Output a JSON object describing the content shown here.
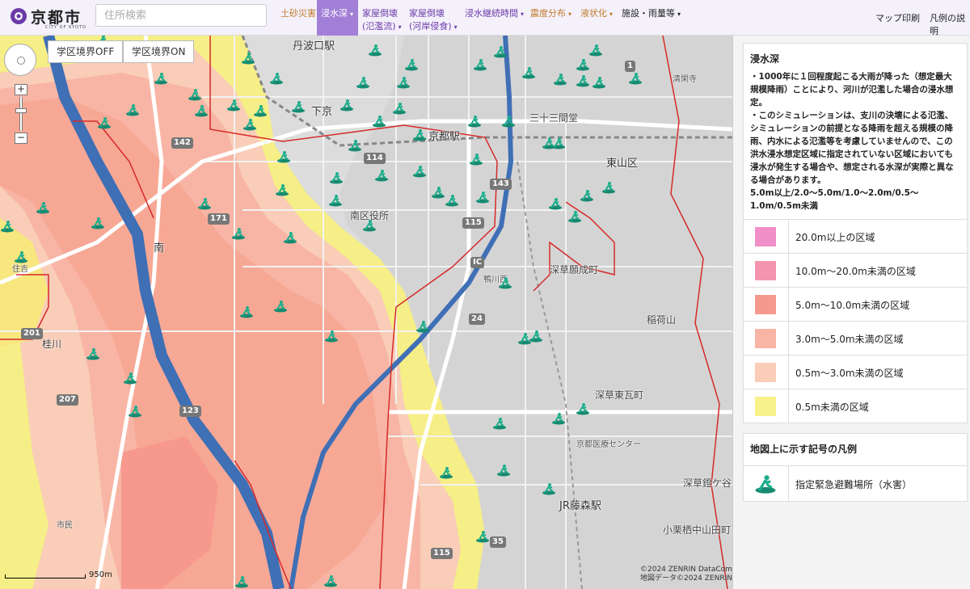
{
  "header": {
    "logo_text": "京都市",
    "logo_sub": "CITY OF KYOTO",
    "search_placeholder": "住所検索",
    "menu": [
      {
        "label": "土砂災害",
        "style": "orange",
        "caret": ""
      },
      {
        "label": "浸水深",
        "style": "active",
        "caret": "▾"
      },
      {
        "label": "家屋倒壊\n(氾濫流)",
        "style": "purple",
        "caret": "▾"
      },
      {
        "label": "家屋倒壊\n(河岸侵食)",
        "style": "purple",
        "caret": "▾"
      },
      {
        "label": "浸水継続時間",
        "style": "purple",
        "caret": "▾"
      },
      {
        "label": "震度分布",
        "style": "orange",
        "caret": "▾"
      },
      {
        "label": "液状化",
        "style": "orange",
        "caret": "▾"
      },
      {
        "label": "施設・雨量等",
        "style": "dark",
        "caret": "▾"
      }
    ],
    "print_label": "マップ印刷",
    "legend_help_label": "凡例の説明"
  },
  "map": {
    "gakku_off": "学区境界OFF",
    "gakku_on": "学区境界ON",
    "zoom_in": "+",
    "zoom_out": "−",
    "scale_label": "950m",
    "copyright_1": "©2024 ZENRIN DataCom",
    "copyright_2": "地図データ©2024 ZENRIN",
    "labels": {
      "tanbaguchi": "丹波口駅",
      "shimogyo": "下京",
      "kyoto_station": "京都駅",
      "sanjusangendo": "三十三間堂",
      "higashiyama": "東山区",
      "minami_office": "南区役所",
      "minami": "南",
      "kamogawa": "鴨川西",
      "fukakusa_ganjo": "深草願成町",
      "inariyama": "稲荷山",
      "fukakusa_higashigawara": "深草東瓦町",
      "medical_center": "京都医療センター",
      "fukakusa_kuruma": "深草鐙ケ谷",
      "jr_fujinomori": "JR藤森駅",
      "okurusu": "小栗栖中山田町",
      "seikanji": "清閑寺",
      "sumiyoshi": "住吉",
      "katsura": "桂川",
      "oyamazaki": "市民"
    },
    "shields": [
      "114",
      "143",
      "115",
      "24",
      "115",
      "35",
      "123",
      "201",
      "207",
      "171",
      "142",
      "1",
      "IC"
    ]
  },
  "legend": {
    "title": "浸水深",
    "description_1": "・1000年に１回程度起こる大雨が降った（想定最大規模降雨）ことにより、河川が氾濫した場合の浸水想定。",
    "description_2": "・このシミュレーションは、支川の決壊による氾濫、シミュレーションの前提となる降雨を超える規模の降雨、内水による氾濫等を考慮していませんので、この洪水浸水想定区域に指定されていない区域においても浸水が発生する場合や、想定される水深が実際と異なる場合があります。",
    "description_3": "5.0m以上/2.0〜5.0m/1.0〜2.0m/0.5〜1.0m/0.5m未満",
    "items": [
      {
        "label": "20.0m以上の区域",
        "color": "#f08fc8"
      },
      {
        "label": "10.0m〜20.0m未満の区域",
        "color": "#f595ad"
      },
      {
        "label": "5.0m〜10.0m未満の区域",
        "color": "#f7988e"
      },
      {
        "label": "3.0m〜5.0m未満の区域",
        "color": "#f8b5a5"
      },
      {
        "label": "0.5m〜3.0m未満の区域",
        "color": "#f9cdb7"
      },
      {
        "label": "0.5m未満の区域",
        "color": "#f7f28a"
      }
    ]
  },
  "symbols": {
    "title": "地図上に示す記号の凡例",
    "items": [
      {
        "label": "指定緊急避難場所（水害）",
        "icon": "evacuation-shelter-icon",
        "color": "#1bae8c"
      }
    ]
  },
  "colors": {
    "accent": "#a27fd6",
    "river": "#3f6fb5",
    "boundary": "#d62a2a",
    "shelter": "#1bae8c"
  }
}
